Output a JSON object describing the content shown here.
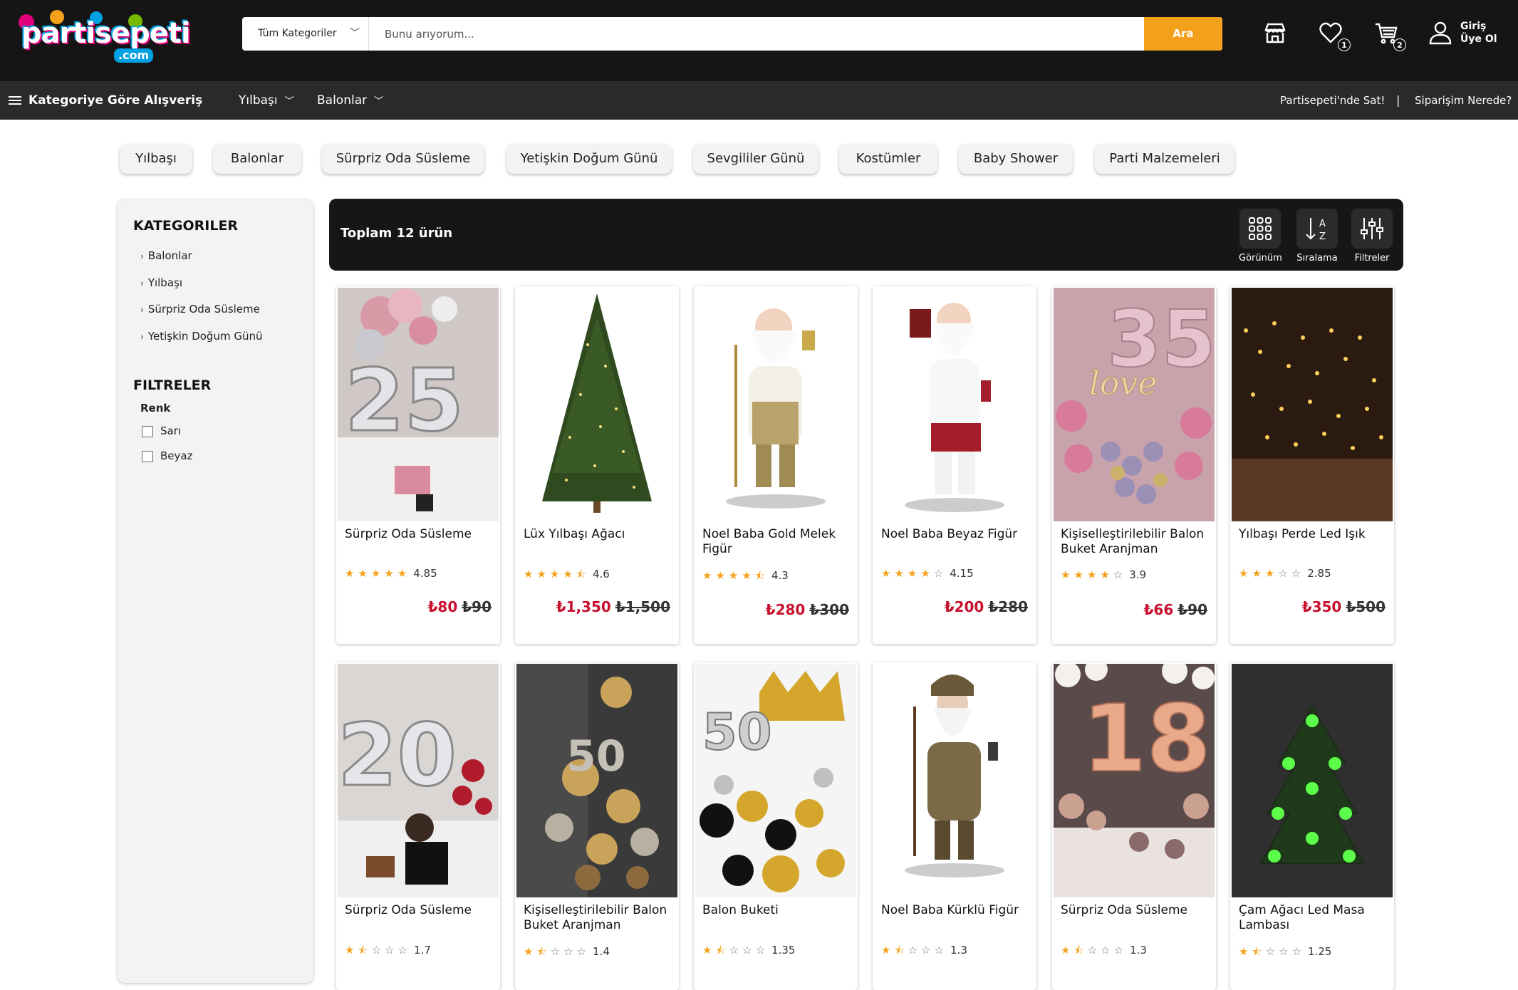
{
  "brand": {
    "logo_text": "partisepeti",
    "logo_domain": ".com"
  },
  "search": {
    "category_label": "Tüm Kategoriler",
    "placeholder": "Bunu arıyorum...",
    "button_label": "Ara"
  },
  "header": {
    "wishlist_count": "1",
    "cart_count": "2",
    "login_line1": "Giriş",
    "login_line2": "Üye Ol"
  },
  "nav": {
    "shop_by_category": "Kategoriye Göre Alışveriş",
    "menus": [
      "Yılbaşı",
      "Balonlar"
    ],
    "sell_link": "Partisepeti'nde Sat!",
    "separator": "|",
    "order_tracking": "Siparişim Nerede?"
  },
  "pills": [
    "Yılbaşı",
    "Balonlar",
    "Sürpriz Oda Süsleme",
    "Yetişkin Doğum Günü",
    "Sevgililer Günü",
    "Kostümler",
    "Baby Shower",
    "Parti Malzemeleri"
  ],
  "sidebar": {
    "categories_title": "KATEGORILER",
    "categories": [
      "Balonlar",
      "Yılbaşı",
      "Sürpriz Oda Süsleme",
      "Yetişkin Doğum Günü"
    ],
    "filters_title": "FILTRELER",
    "color_label": "Renk",
    "colors": [
      "Sarı",
      "Beyaz"
    ]
  },
  "results": {
    "total_text": "Toplam 12 ürün",
    "tools": [
      "Görünüm",
      "Sıralama",
      "Filtreler"
    ]
  },
  "products": [
    {
      "name": "Sürpriz Oda Süsleme",
      "rating": "4.85",
      "stars": 5,
      "price": "₺80",
      "old_price": "₺90",
      "image": "silver-25-balloons"
    },
    {
      "name": "Lüx Yılbaşı Ağacı",
      "rating": "4.6",
      "stars": 4.5,
      "price": "₺1,350",
      "old_price": "₺1,500",
      "image": "christmas-tree"
    },
    {
      "name": "Noel Baba Gold Melek Figür",
      "rating": "4.3",
      "stars": 4.5,
      "price": "₺280",
      "old_price": "₺300",
      "image": "santa-gold-figure"
    },
    {
      "name": "Noel Baba Beyaz Figür",
      "rating": "4.15",
      "stars": 4,
      "price": "₺200",
      "old_price": "₺280",
      "image": "santa-white-figure"
    },
    {
      "name": "Kişiselleştirilebilir Balon Buket Aranjman",
      "rating": "3.9",
      "stars": 4,
      "price": "₺66",
      "old_price": "₺90",
      "image": "love-35-balloons"
    },
    {
      "name": "Yılbaşı Perde Led Işık",
      "rating": "2.85",
      "stars": 3,
      "price": "₺350",
      "old_price": "₺500",
      "image": "curtain-led-lights"
    },
    {
      "name": "Sürpriz Oda Süsleme",
      "rating": "1.7",
      "stars": 1.5,
      "price": "",
      "old_price": "",
      "image": "silver-20-balloons"
    },
    {
      "name": "Kişiselleştirilebilir Balon Buket Aranjman",
      "rating": "1.4",
      "stars": 1.5,
      "price": "",
      "old_price": "",
      "image": "gold-balloon-bouquet"
    },
    {
      "name": "Balon Buketi",
      "rating": "1.35",
      "stars": 1.5,
      "price": "",
      "old_price": "",
      "image": "50-crown-balloons"
    },
    {
      "name": "Noel Baba Kürklü Figür",
      "rating": "1.3",
      "stars": 1.5,
      "price": "",
      "old_price": "",
      "image": "santa-fur-figure"
    },
    {
      "name": "Sürpriz Oda Süsleme",
      "rating": "1.3",
      "stars": 1.5,
      "price": "",
      "old_price": "",
      "image": "rose-gold-18-balloons"
    },
    {
      "name": "Çam Ağacı Led Masa Lambası",
      "rating": "1.25",
      "stars": 1.5,
      "price": "",
      "old_price": "",
      "image": "tree-led-lamp"
    }
  ],
  "colors": {
    "accent": "#f3a11b",
    "price": "#c8102e",
    "header_bg": "#151515",
    "nav_bg": "#2a2a2a"
  }
}
